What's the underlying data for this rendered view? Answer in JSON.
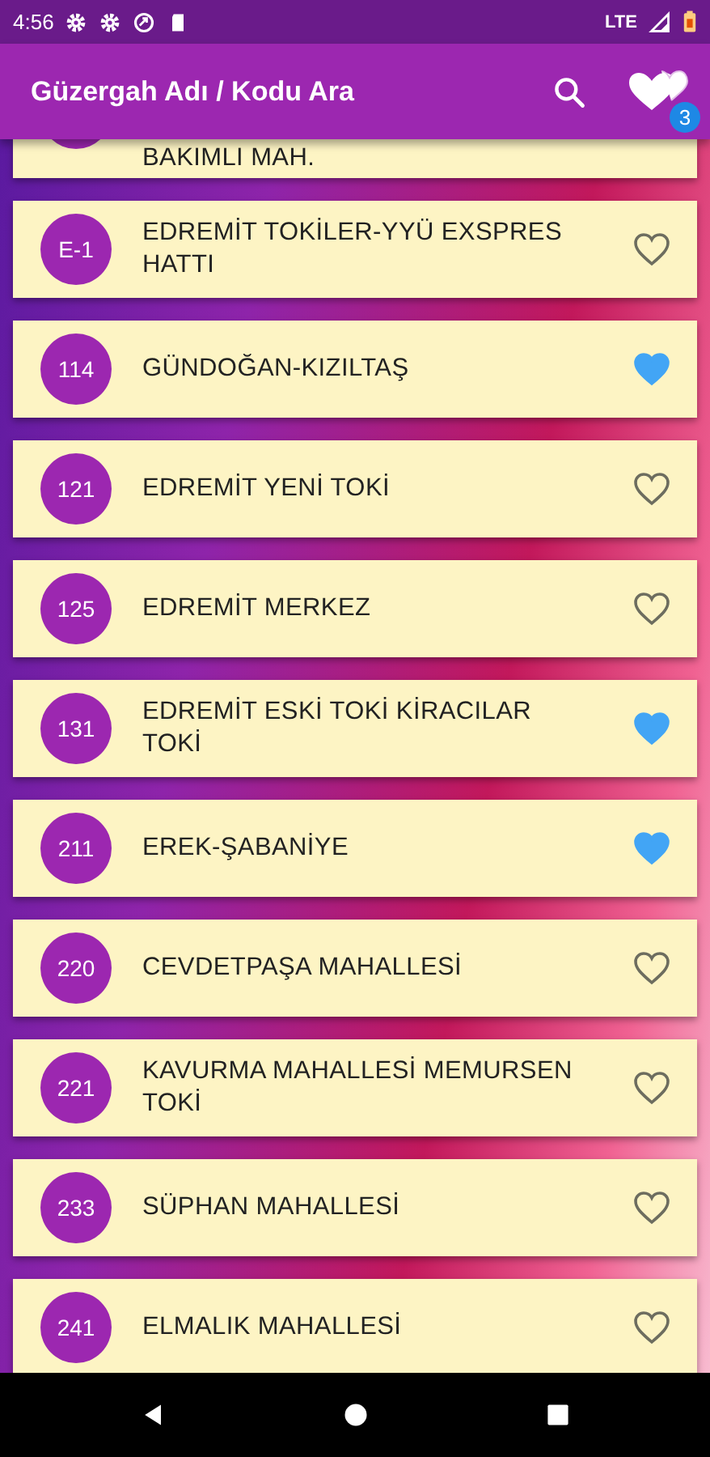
{
  "status_bar": {
    "time": "4:56",
    "network": "LTE"
  },
  "app_bar": {
    "title": "Güzergah Adı / Kodu Ara",
    "favorites_count": "3"
  },
  "routes": [
    {
      "kind": "partial",
      "name": "BAKIMLI MAH."
    },
    {
      "kind": "full",
      "code": "E-1",
      "name": "EDREMİT TOKİLER-YYÜ EXSPRES HATTI",
      "favorite": false
    },
    {
      "kind": "full",
      "code": "114",
      "name": "GÜNDOĞAN-KIZILTAŞ",
      "favorite": true
    },
    {
      "kind": "full",
      "code": "121",
      "name": "EDREMİT YENİ TOKİ",
      "favorite": false
    },
    {
      "kind": "full",
      "code": "125",
      "name": "EDREMİT MERKEZ",
      "favorite": false
    },
    {
      "kind": "full",
      "code": "131",
      "name": "EDREMİT ESKİ TOKİ KİRACILAR TOKİ",
      "favorite": true
    },
    {
      "kind": "full",
      "code": "211",
      "name": "EREK-ŞABANİYE",
      "favorite": true
    },
    {
      "kind": "full",
      "code": "220",
      "name": "CEVDETPAŞA MAHALLESİ",
      "favorite": false
    },
    {
      "kind": "full",
      "code": "221",
      "name": "KAVURMA MAHALLESİ MEMURSEN TOKİ",
      "favorite": false
    },
    {
      "kind": "full",
      "code": "233",
      "name": "SÜPHAN MAHALLESİ",
      "favorite": false
    },
    {
      "kind": "full",
      "code": "241",
      "name": "ELMALIK MAHALLESİ",
      "favorite": false
    }
  ]
}
